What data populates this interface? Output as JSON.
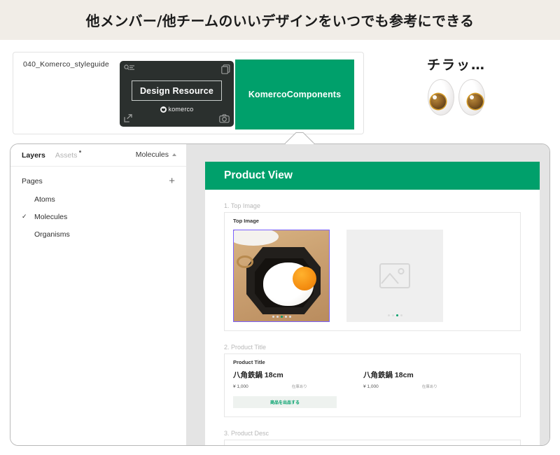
{
  "banner": {
    "title": "他メンバー/他チームのいいデザインをいつでも参考にできる"
  },
  "file_card": {
    "file_name": "040_Komerco_styleguide",
    "dark_thumb": {
      "title": "Design Resource",
      "brand": "komerco",
      "icons": [
        "search-list-icon",
        "copy-icon",
        "export-icon",
        "camera-icon"
      ]
    },
    "green_thumb": {
      "title": "KomercoComponents",
      "color": "#00A06B"
    }
  },
  "chirari": {
    "text": "チラッ…",
    "icon": "eyes-icon"
  },
  "figma": {
    "sidebar": {
      "tabs": [
        {
          "label": "Layers",
          "active": true
        },
        {
          "label": "Assets",
          "active": false,
          "badge": true
        }
      ],
      "page_selector": {
        "value": "Molecules",
        "icon": "chevron-up-icon"
      },
      "pages_label": "Pages",
      "add_page_icon": "+",
      "pages": [
        {
          "label": "Atoms",
          "selected": false
        },
        {
          "label": "Molecules",
          "selected": true
        },
        {
          "label": "Organisms",
          "selected": false
        }
      ]
    },
    "canvas": {
      "artboard_title": "Product View",
      "accent": "#00A06B",
      "sections": [
        {
          "label": "1. Top Image",
          "box_title": "Top Image",
          "items": [
            {
              "type": "photo-selected",
              "alt": "egg in cast iron pan"
            },
            {
              "type": "image-placeholder",
              "icon": "image-icon"
            }
          ]
        },
        {
          "label": "2. Product Title",
          "box_title": "Product Title",
          "products": [
            {
              "title": "八角鉄鍋 18cm",
              "price": "¥ 1,000",
              "stock": "在庫あり"
            },
            {
              "title": "八角鉄鍋 18cm",
              "price": "¥ 1,000",
              "stock": "在庫あり"
            }
          ],
          "cta_label": "商品を出品する"
        },
        {
          "label": "3. Product Desc"
        }
      ]
    }
  }
}
